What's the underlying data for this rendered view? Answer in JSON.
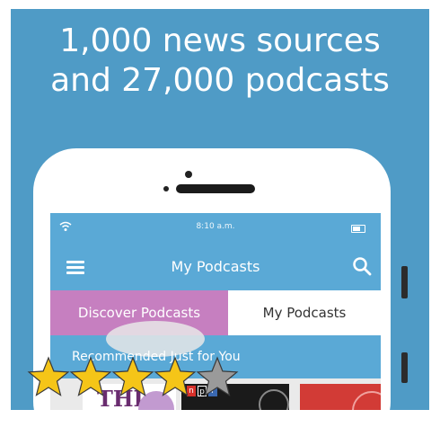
{
  "headline": {
    "line1": "1,000 news sources",
    "line2": "and 27,000 podcasts"
  },
  "status_bar": {
    "time": "8:10 a.m.",
    "wifi_icon": "wifi-icon",
    "battery_icon": "battery-icon"
  },
  "navbar": {
    "title": "My Podcasts",
    "menu_icon": "hamburger-menu-icon",
    "search_icon": "search-icon"
  },
  "tabs": [
    {
      "label": "Discover Podcasts",
      "active": true
    },
    {
      "label": "My Podcasts",
      "active": false
    }
  ],
  "section": {
    "title": "Recommended Just for You"
  },
  "thumbnails": [
    {
      "label": "THI"
    },
    {
      "label": "npr"
    },
    {
      "label": ""
    }
  ],
  "rating": {
    "stars_filled": 4,
    "stars_total": 5
  },
  "colors": {
    "promo_background": "#4f9bc6",
    "app_bar": "#5aa9d6",
    "tab_active": "#c67fc0",
    "star_filled": "#f5c518",
    "star_empty": "#9a9a9a"
  }
}
